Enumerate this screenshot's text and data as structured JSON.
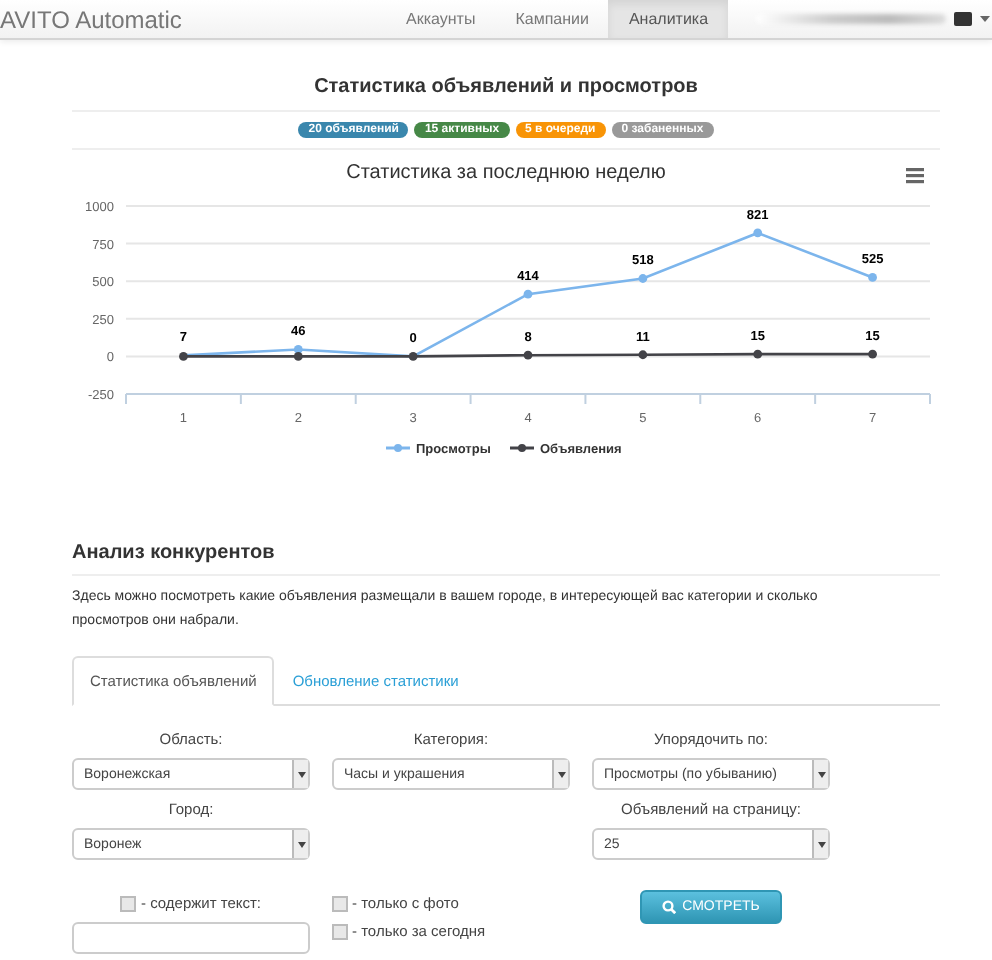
{
  "navbar": {
    "brand": "AVITO Automatic",
    "items": [
      {
        "label": "Аккаунты",
        "selected": false
      },
      {
        "label": "Кампании",
        "selected": false
      },
      {
        "label": "Аналитика",
        "selected": true
      }
    ]
  },
  "stats": {
    "title": "Статистика объявлений и просмотров",
    "badges": [
      {
        "text": "20 объявлений",
        "color": "#3a87ad"
      },
      {
        "text": "15 активных",
        "color": "#468847"
      },
      {
        "text": "5 в очереди",
        "color": "#f89406"
      },
      {
        "text": "0 забаненных",
        "color": "#999999"
      }
    ],
    "chart_data": {
      "type": "line",
      "title": "Статистика за последнюю неделю",
      "categories": [
        "1",
        "2",
        "3",
        "4",
        "5",
        "6",
        "7"
      ],
      "series": [
        {
          "name": "Просмотры",
          "color": "#7cb5ec",
          "marker": "circle",
          "values": [
            7,
            46,
            0,
            414,
            518,
            821,
            525
          ]
        },
        {
          "name": "Объявления",
          "color": "#434348",
          "marker": "circle",
          "values": [
            0,
            0,
            0,
            8,
            11,
            15,
            15
          ]
        }
      ],
      "value_labels": [
        [
          "7",
          "46",
          "0",
          "414",
          "518",
          "821",
          "525"
        ],
        [
          null,
          null,
          null,
          "8",
          "11",
          "15",
          "15"
        ]
      ],
      "grid": true,
      "legend": "bottom",
      "ylim": [
        -250,
        1000
      ],
      "yticks": [
        -250,
        0,
        250,
        500,
        750,
        1000
      ]
    }
  },
  "competitors": {
    "title": "Анализ конкурентов",
    "description": "Здесь можно посмотреть какие объявления размещали в вашем городе, в интересующей вас категории и сколько просмотров они набрали.",
    "tabs": [
      {
        "label": "Статистика объявлений",
        "selected": true
      },
      {
        "label": "Обновление статистики",
        "selected": false
      }
    ],
    "select_rows": [
      [
        {
          "label": "Область:",
          "value": "Воронежская"
        },
        {
          "label": "Категория:",
          "value": "Часы и украшения"
        },
        {
          "label": "Упорядочить по:",
          "value": "Просмотры (по убыванию)"
        }
      ],
      [
        {
          "label": "Город:",
          "value": "Воронеж"
        },
        {
          "label": "Объявлений на страницу:",
          "value": "25"
        }
      ]
    ],
    "text_filter": {
      "label": "- содержит текст:",
      "checked": false
    },
    "checkboxes": [
      {
        "label": "- только с фото",
        "checked": false
      },
      {
        "label": "- только за сегодня",
        "checked": false
      }
    ],
    "button": "СМОТРЕТЬ"
  }
}
